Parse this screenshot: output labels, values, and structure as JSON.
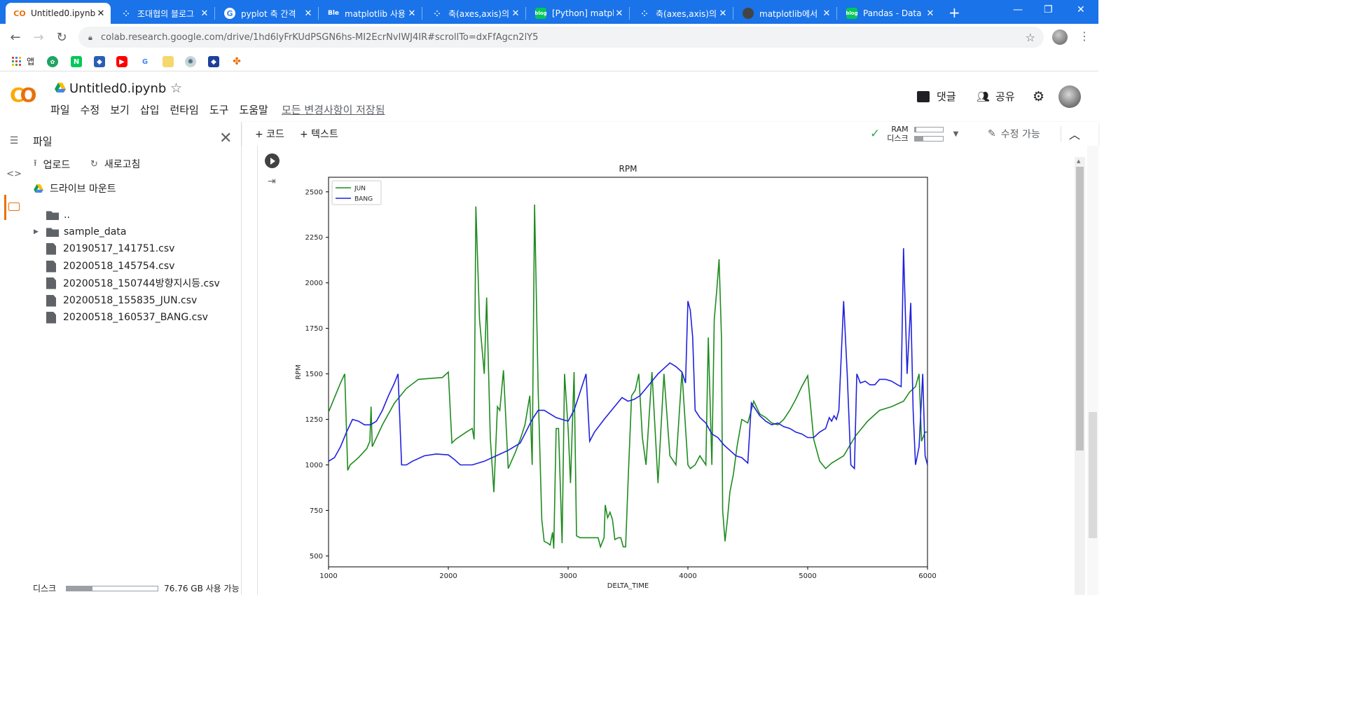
{
  "browser": {
    "tabs": [
      {
        "title": "Untitled0.ipynb",
        "favicon": "colab-icon",
        "active": true
      },
      {
        "title": "조대협의 블로그",
        "favicon": "tistory-icon",
        "active": false
      },
      {
        "title": "pyplot 축 간격",
        "favicon": "google-icon",
        "active": false
      },
      {
        "title": "matplotlib 사용",
        "favicon": "blog-icon",
        "active": false
      },
      {
        "title": "축(axes,axis)의",
        "favicon": "tistory-icon",
        "active": false
      },
      {
        "title": "[Python] matpl",
        "favicon": "blog-icon",
        "active": false
      },
      {
        "title": "축(axes,axis)의",
        "favicon": "tistory-icon",
        "active": false
      },
      {
        "title": "matplotlib에서",
        "favicon": "github-icon",
        "active": false
      },
      {
        "title": "Pandas - Data",
        "favicon": "blog-icon",
        "active": false
      }
    ],
    "url": "colab.research.google.com/drive/1hd6lyFrKUdPSGN6hs-MI2EcrNvIWJ4IR#scrollTo=dxFfAgcn2lY5",
    "bookmarks_apps_label": "앱"
  },
  "colab": {
    "notebook_title": "Untitled0.ipynb",
    "menu": [
      "파일",
      "수정",
      "보기",
      "삽입",
      "런타임",
      "도구",
      "도움말"
    ],
    "saved_status": "모든 변경사항이 저장됨",
    "comments_label": "댓글",
    "share_label": "공유",
    "toolbar": {
      "add_code": "+ 코드",
      "add_text": "+ 텍스트",
      "ram_label": "RAM",
      "disk_label": "디스크",
      "ram_fraction": 0.05,
      "disk_fraction": 0.3,
      "edit_mode": "수정 가능"
    }
  },
  "files_panel": {
    "title": "파일",
    "upload_label": "업로드",
    "refresh_label": "새로고침",
    "mount_label": "드라이브 마운트",
    "items": [
      {
        "name": "..",
        "kind": "parent"
      },
      {
        "name": "sample_data",
        "kind": "folder"
      },
      {
        "name": "20190517_141751.csv",
        "kind": "file"
      },
      {
        "name": "20200518_145754.csv",
        "kind": "file"
      },
      {
        "name": "20200518_150744방향지시등.csv",
        "kind": "file"
      },
      {
        "name": "20200518_155835_JUN.csv",
        "kind": "file"
      },
      {
        "name": "20200518_160537_BANG.csv",
        "kind": "file"
      }
    ],
    "disk_label": "디스크",
    "disk_fraction": 0.28,
    "disk_free": "76.76 GB 사용 가능"
  },
  "chart_data": {
    "type": "line",
    "title": "RPM",
    "xlabel": "DELTA_TIME",
    "ylabel": "RPM",
    "xlim": [
      1000,
      6000
    ],
    "ylim": [
      440,
      2580
    ],
    "xticks": [
      1000,
      2000,
      3000,
      4000,
      5000,
      6000
    ],
    "yticks": [
      500,
      750,
      1000,
      1250,
      1500,
      1750,
      2000,
      2250,
      2500
    ],
    "grid": false,
    "legend": "top-left",
    "series": [
      {
        "name": "JUN",
        "color": "#1f8b1f",
        "points": [
          [
            1000,
            1290
          ],
          [
            1050,
            1370
          ],
          [
            1100,
            1450
          ],
          [
            1135,
            1500
          ],
          [
            1160,
            970
          ],
          [
            1180,
            1000
          ],
          [
            1250,
            1040
          ],
          [
            1320,
            1090
          ],
          [
            1345,
            1130
          ],
          [
            1355,
            1320
          ],
          [
            1365,
            1100
          ],
          [
            1450,
            1220
          ],
          [
            1550,
            1340
          ],
          [
            1650,
            1420
          ],
          [
            1750,
            1470
          ],
          [
            1850,
            1475
          ],
          [
            1950,
            1480
          ],
          [
            2000,
            1510
          ],
          [
            2030,
            1120
          ],
          [
            2060,
            1140
          ],
          [
            2150,
            1180
          ],
          [
            2200,
            1200
          ],
          [
            2215,
            1140
          ],
          [
            2230,
            2420
          ],
          [
            2260,
            1800
          ],
          [
            2300,
            1500
          ],
          [
            2320,
            1920
          ],
          [
            2350,
            1150
          ],
          [
            2380,
            850
          ],
          [
            2410,
            1320
          ],
          [
            2430,
            1300
          ],
          [
            2460,
            1520
          ],
          [
            2500,
            980
          ],
          [
            2560,
            1070
          ],
          [
            2600,
            1140
          ],
          [
            2640,
            1220
          ],
          [
            2680,
            1380
          ],
          [
            2700,
            1000
          ],
          [
            2720,
            2430
          ],
          [
            2750,
            1400
          ],
          [
            2780,
            700
          ],
          [
            2800,
            580
          ],
          [
            2830,
            570
          ],
          [
            2850,
            560
          ],
          [
            2870,
            630
          ],
          [
            2880,
            540
          ],
          [
            2900,
            1200
          ],
          [
            2920,
            1200
          ],
          [
            2950,
            570
          ],
          [
            2970,
            1500
          ],
          [
            3000,
            1200
          ],
          [
            3020,
            900
          ],
          [
            3050,
            1510
          ],
          [
            3070,
            610
          ],
          [
            3100,
            600
          ],
          [
            3150,
            600
          ],
          [
            3200,
            600
          ],
          [
            3250,
            600
          ],
          [
            3270,
            550
          ],
          [
            3300,
            600
          ],
          [
            3310,
            780
          ],
          [
            3330,
            710
          ],
          [
            3350,
            740
          ],
          [
            3370,
            700
          ],
          [
            3390,
            590
          ],
          [
            3420,
            600
          ],
          [
            3440,
            600
          ],
          [
            3460,
            550
          ],
          [
            3480,
            550
          ],
          [
            3500,
            900
          ],
          [
            3530,
            1380
          ],
          [
            3560,
            1410
          ],
          [
            3590,
            1500
          ],
          [
            3620,
            1150
          ],
          [
            3650,
            1000
          ],
          [
            3700,
            1510
          ],
          [
            3750,
            900
          ],
          [
            3800,
            1500
          ],
          [
            3850,
            1050
          ],
          [
            3900,
            1000
          ],
          [
            3950,
            1510
          ],
          [
            4000,
            1000
          ],
          [
            4020,
            980
          ],
          [
            4060,
            1000
          ],
          [
            4100,
            1050
          ],
          [
            4150,
            1000
          ],
          [
            4170,
            1700
          ],
          [
            4200,
            1000
          ],
          [
            4220,
            1800
          ],
          [
            4240,
            1950
          ],
          [
            4260,
            2130
          ],
          [
            4280,
            1700
          ],
          [
            4290,
            750
          ],
          [
            4310,
            580
          ],
          [
            4330,
            700
          ],
          [
            4350,
            850
          ],
          [
            4380,
            950
          ],
          [
            4410,
            1100
          ],
          [
            4450,
            1250
          ],
          [
            4500,
            1230
          ],
          [
            4550,
            1350
          ],
          [
            4600,
            1280
          ],
          [
            4650,
            1260
          ],
          [
            4700,
            1230
          ],
          [
            4750,
            1220
          ],
          [
            4800,
            1250
          ],
          [
            4850,
            1300
          ],
          [
            4900,
            1360
          ],
          [
            4950,
            1430
          ],
          [
            5000,
            1490
          ],
          [
            5050,
            1140
          ],
          [
            5100,
            1020
          ],
          [
            5150,
            980
          ],
          [
            5200,
            1010
          ],
          [
            5300,
            1050
          ],
          [
            5400,
            1160
          ],
          [
            5500,
            1240
          ],
          [
            5600,
            1300
          ],
          [
            5700,
            1320
          ],
          [
            5800,
            1350
          ],
          [
            5850,
            1400
          ],
          [
            5900,
            1430
          ],
          [
            5930,
            1500
          ],
          [
            5950,
            1130
          ],
          [
            5980,
            1180
          ],
          [
            6000,
            1180
          ]
        ]
      },
      {
        "name": "BANG",
        "color": "#2020e0",
        "points": [
          [
            1000,
            1020
          ],
          [
            1050,
            1040
          ],
          [
            1100,
            1100
          ],
          [
            1150,
            1180
          ],
          [
            1200,
            1250
          ],
          [
            1250,
            1240
          ],
          [
            1300,
            1220
          ],
          [
            1350,
            1220
          ],
          [
            1400,
            1240
          ],
          [
            1450,
            1300
          ],
          [
            1500,
            1380
          ],
          [
            1550,
            1450
          ],
          [
            1580,
            1500
          ],
          [
            1610,
            1000
          ],
          [
            1650,
            1000
          ],
          [
            1700,
            1020
          ],
          [
            1800,
            1050
          ],
          [
            1900,
            1060
          ],
          [
            2000,
            1055
          ],
          [
            2050,
            1030
          ],
          [
            2100,
            1000
          ],
          [
            2200,
            1000
          ],
          [
            2300,
            1020
          ],
          [
            2400,
            1050
          ],
          [
            2500,
            1080
          ],
          [
            2600,
            1120
          ],
          [
            2700,
            1250
          ],
          [
            2750,
            1300
          ],
          [
            2800,
            1300
          ],
          [
            2850,
            1280
          ],
          [
            2900,
            1260
          ],
          [
            2950,
            1250
          ],
          [
            3000,
            1240
          ],
          [
            3050,
            1300
          ],
          [
            3100,
            1400
          ],
          [
            3150,
            1500
          ],
          [
            3180,
            1130
          ],
          [
            3220,
            1180
          ],
          [
            3300,
            1250
          ],
          [
            3400,
            1330
          ],
          [
            3450,
            1370
          ],
          [
            3500,
            1350
          ],
          [
            3550,
            1360
          ],
          [
            3600,
            1380
          ],
          [
            3650,
            1420
          ],
          [
            3700,
            1460
          ],
          [
            3750,
            1500
          ],
          [
            3800,
            1530
          ],
          [
            3850,
            1560
          ],
          [
            3900,
            1540
          ],
          [
            3950,
            1510
          ],
          [
            3980,
            1450
          ],
          [
            4000,
            1900
          ],
          [
            4020,
            1850
          ],
          [
            4040,
            1700
          ],
          [
            4060,
            1300
          ],
          [
            4100,
            1260
          ],
          [
            4150,
            1230
          ],
          [
            4200,
            1170
          ],
          [
            4250,
            1150
          ],
          [
            4300,
            1110
          ],
          [
            4350,
            1080
          ],
          [
            4400,
            1050
          ],
          [
            4450,
            1040
          ],
          [
            4500,
            1010
          ],
          [
            4530,
            1340
          ],
          [
            4560,
            1310
          ],
          [
            4600,
            1270
          ],
          [
            4650,
            1240
          ],
          [
            4700,
            1220
          ],
          [
            4750,
            1230
          ],
          [
            4800,
            1210
          ],
          [
            4850,
            1200
          ],
          [
            4900,
            1180
          ],
          [
            4950,
            1170
          ],
          [
            5000,
            1150
          ],
          [
            5050,
            1150
          ],
          [
            5100,
            1180
          ],
          [
            5150,
            1200
          ],
          [
            5180,
            1260
          ],
          [
            5200,
            1240
          ],
          [
            5220,
            1270
          ],
          [
            5240,
            1250
          ],
          [
            5260,
            1300
          ],
          [
            5300,
            1900
          ],
          [
            5330,
            1500
          ],
          [
            5360,
            1000
          ],
          [
            5390,
            980
          ],
          [
            5410,
            1500
          ],
          [
            5440,
            1450
          ],
          [
            5480,
            1460
          ],
          [
            5520,
            1440
          ],
          [
            5560,
            1440
          ],
          [
            5600,
            1470
          ],
          [
            5650,
            1470
          ],
          [
            5700,
            1460
          ],
          [
            5750,
            1440
          ],
          [
            5780,
            1430
          ],
          [
            5800,
            2190
          ],
          [
            5830,
            1500
          ],
          [
            5860,
            1890
          ],
          [
            5880,
            1300
          ],
          [
            5900,
            1000
          ],
          [
            5930,
            1100
          ],
          [
            5960,
            1500
          ],
          [
            5980,
            1050
          ],
          [
            6000,
            1000
          ]
        ]
      }
    ]
  }
}
